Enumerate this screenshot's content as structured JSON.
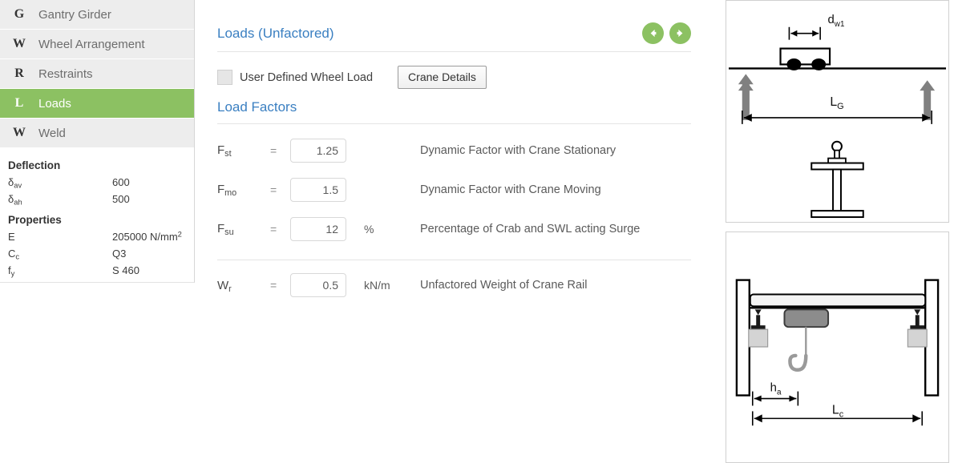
{
  "sidebar": {
    "items": [
      {
        "letter": "G",
        "label": "Gantry Girder",
        "active": false
      },
      {
        "letter": "W",
        "label": "Wheel Arrangement",
        "active": false
      },
      {
        "letter": "R",
        "label": "Restraints",
        "active": false
      },
      {
        "letter": "L",
        "label": "Loads",
        "active": true
      },
      {
        "letter": "W",
        "label": "Weld",
        "active": false
      }
    ],
    "deflection": {
      "heading": "Deflection",
      "rows": [
        {
          "key": "δav",
          "key_base": "δ",
          "key_sub": "av",
          "value": "600"
        },
        {
          "key": "δah",
          "key_base": "δ",
          "key_sub": "ah",
          "value": "500"
        }
      ]
    },
    "properties": {
      "heading": "Properties",
      "rows": [
        {
          "key_base": "E",
          "key_sub": "",
          "value": "205000 N/mm²",
          "value_base": "205000 N/mm",
          "value_sup": "2"
        },
        {
          "key_base": "C",
          "key_sub": "c",
          "value": "Q3",
          "value_base": "Q3",
          "value_sup": ""
        },
        {
          "key_base": "f",
          "key_sub": "y",
          "value": "S 460",
          "value_base": "S 460",
          "value_sup": ""
        }
      ]
    }
  },
  "main": {
    "title": "Loads (Unfactored)",
    "prev_arrow_icon": "arrow-left-circle-icon",
    "next_arrow_icon": "arrow-right-circle-icon",
    "checkbox_label": "User Defined Wheel Load",
    "checkbox_checked": false,
    "crane_details_button": "Crane Details",
    "subsection_title": "Load Factors",
    "equals_sign": "=",
    "fields": [
      {
        "symbol_base": "F",
        "symbol_sub": "st",
        "value": "1.25",
        "unit": "",
        "description": "Dynamic Factor with Crane Stationary"
      },
      {
        "symbol_base": "F",
        "symbol_sub": "mo",
        "value": "1.5",
        "unit": "",
        "description": "Dynamic Factor with Crane Moving"
      },
      {
        "symbol_base": "F",
        "symbol_sub": "su",
        "value": "12",
        "unit": "%",
        "description": "Percentage of Crab and SWL acting Surge"
      }
    ],
    "fields2": [
      {
        "symbol_base": "W",
        "symbol_sub": "r",
        "value": "0.5",
        "unit": "kN/m",
        "description": "Unfactored Weight of Crane Rail"
      }
    ]
  },
  "diagrams": {
    "top": {
      "name": "gantry-girder-elevation-diagram",
      "labels": {
        "wheel_spacing": "dw1",
        "wheel_spacing_base": "d",
        "wheel_spacing_sub": "w1",
        "girder_span_base": "L",
        "girder_span_sub": "G"
      }
    },
    "bottom": {
      "name": "crane-bay-section-diagram",
      "labels": {
        "hook_approach_base": "h",
        "hook_approach_sub": "a",
        "crane_span_base": "L",
        "crane_span_sub": "c"
      }
    }
  },
  "colors": {
    "accent_green": "#8cc162",
    "link_blue": "#3a7fc1",
    "sidebar_item_bg": "#ededed"
  }
}
